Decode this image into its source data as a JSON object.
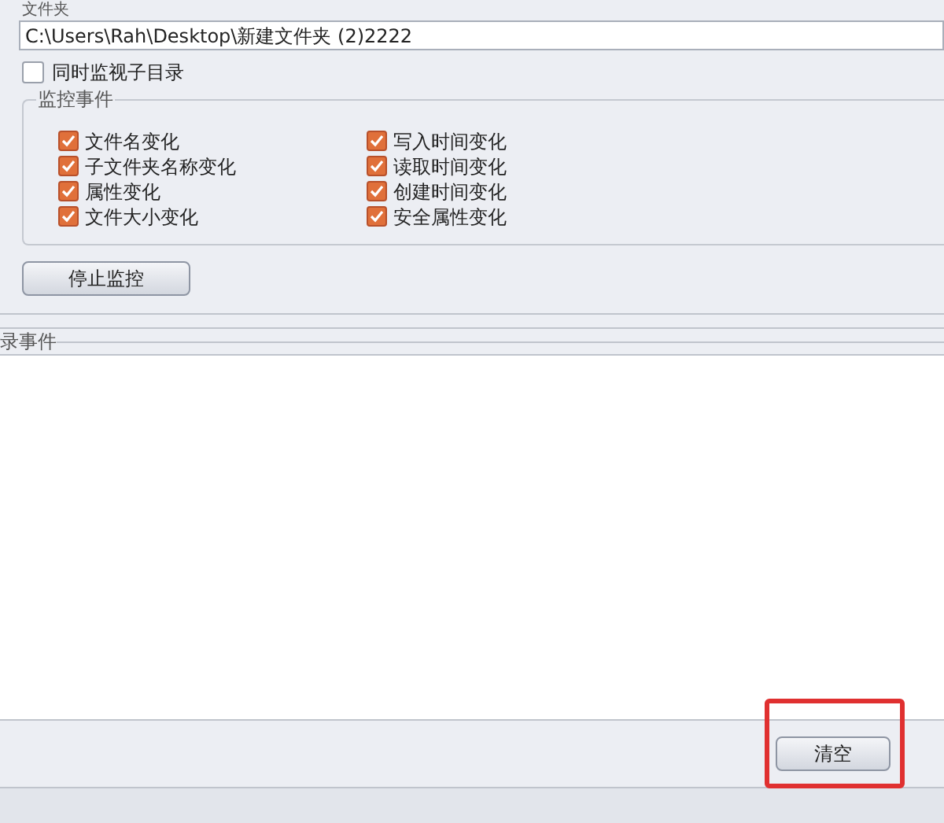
{
  "folder_label": "文件夹",
  "folder_path": "C:\\Users\\Rah\\Desktop\\新建文件夹 (2)2222",
  "watch_subdirs": {
    "label": "同时监视子目录",
    "checked": false
  },
  "events_group": {
    "title": "监控事件",
    "items": [
      {
        "label": "文件名变化",
        "checked": true
      },
      {
        "label": "写入时间变化",
        "checked": true
      },
      {
        "label": "子文件夹名称变化",
        "checked": true
      },
      {
        "label": "读取时间变化",
        "checked": true
      },
      {
        "label": "属性变化",
        "checked": true
      },
      {
        "label": "创建时间变化",
        "checked": true
      },
      {
        "label": "文件大小变化",
        "checked": true
      },
      {
        "label": "安全属性变化",
        "checked": true
      }
    ]
  },
  "stop_button": "停止监控",
  "log_label": "录事件",
  "clear_button": {
    "label": "清空",
    "highlighted": true
  }
}
